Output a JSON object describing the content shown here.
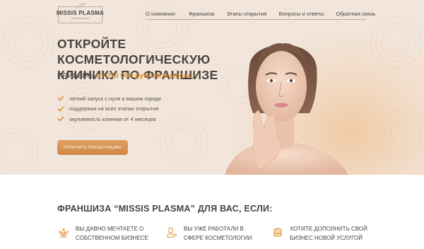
{
  "logo": {
    "name": "MISSIS PLASMA",
    "tagline": "cosmetologist"
  },
  "nav": {
    "items": [
      "О компании",
      "Франшиза",
      "Этапы открытия",
      "Вопросы и ответы",
      "Обратная связь"
    ]
  },
  "hero": {
    "headline_line1": "ОТКРОЙТЕ КОСМЕТОЛОГИЧЕСКУЮ",
    "headline_line2": "КЛИНИКУ ПО ФРАНШИЗЕ",
    "profit_prefix": "ПРИБЫЛЬ",
    "profit_value": "от 250 000 рублей в месяц",
    "features": [
      "легкий запуск с нуля в вашем городе",
      "поддержка на всех этапах открытия",
      "окупаемость клиники от 4 месяцев"
    ],
    "cta_label": "ПОЛУЧИТЬ ПРЕЗЕНТАЦИЮ"
  },
  "section": {
    "title": "ФРАНШИЗА “MISSIS PLASMA” ДЛЯ ВАС, ЕСЛИ:",
    "cards": [
      {
        "line1": "ВЫ ДАВНО МЕЧТАЕТЕ О",
        "line2": "СОБСТВЕННОМ БИЗНЕСЕ",
        "icon": "lotus-icon"
      },
      {
        "line1": "ВЫ УЖЕ РАБОТАЛИ В",
        "line2": "СФЕРЕ КОСМЕТОЛОГИИ",
        "icon": "hand-lotion-icon"
      },
      {
        "line1": "ХОТИТЕ ДОПОЛНИТЬ СВОЙ",
        "line2": "БИЗНЕС НОВОЙ УСЛУГОЙ",
        "icon": "coins-icon"
      }
    ]
  },
  "colors": {
    "accent": "#d99034",
    "hero_bg": "#f2e6dc",
    "text": "#4a4440"
  }
}
